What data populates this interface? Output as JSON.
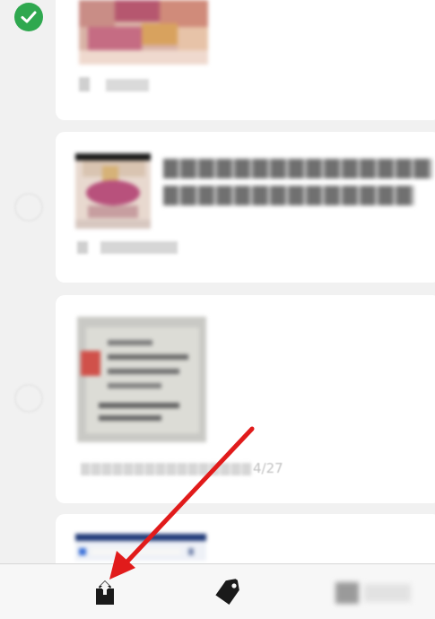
{
  "notes": [
    {
      "selected": true,
      "title": "",
      "meta": "",
      "date_suffix": ""
    },
    {
      "selected": false,
      "title_line1": "",
      "title_line2": "",
      "meta": ""
    },
    {
      "selected": false,
      "title": "",
      "meta_hidden": "",
      "date_suffix": "4/27"
    },
    {
      "selected": false,
      "title": ""
    }
  ],
  "toolbar": {
    "share_icon": "share-icon",
    "tag_icon": "tag-icon",
    "more_icon": "delete-icon"
  },
  "colors": {
    "check_green": "#2fa84f",
    "arrow_red": "#e11b1b",
    "background": "#f1f1f1",
    "card": "#ffffff"
  }
}
